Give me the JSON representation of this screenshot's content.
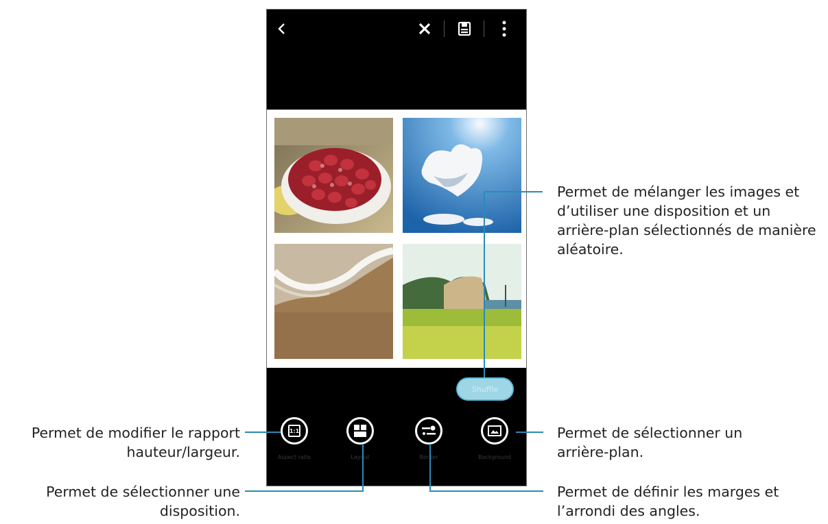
{
  "toolbar": {
    "back_icon": "chevron-left-icon",
    "close_icon": "close-icon",
    "save_icon": "save-icon",
    "more_icon": "more-vert-icon"
  },
  "collage": {
    "images": [
      "strawberry-tart",
      "heart-cloud-sky",
      "beach-wave",
      "coastal-landscape"
    ]
  },
  "shuffle_button": {
    "label": "Shuffle"
  },
  "tools": [
    {
      "icon": "aspect-ratio-icon",
      "label": "Aspect ratio",
      "glyph": "1:1"
    },
    {
      "icon": "layout-icon",
      "label": "Layout"
    },
    {
      "icon": "border-icon",
      "label": "Border"
    },
    {
      "icon": "background-icon",
      "label": "Background"
    }
  ],
  "callouts": {
    "shuffle": "Permet de mélanger les images et d’utiliser une disposition et un arrière-plan sélectionnés de manière aléatoire.",
    "aspect_ratio": "Permet de modifier le rapport hauteur/largeur.",
    "layout": "Permet de sélectionner une disposition.",
    "background": "Permet de sélectionner un arrière-plan.",
    "border": "Permet de définir les marges et l’arrondi des angles."
  },
  "colors": {
    "accent": "#2a8ab8",
    "shuffle_fill": "#9fd6e6"
  }
}
